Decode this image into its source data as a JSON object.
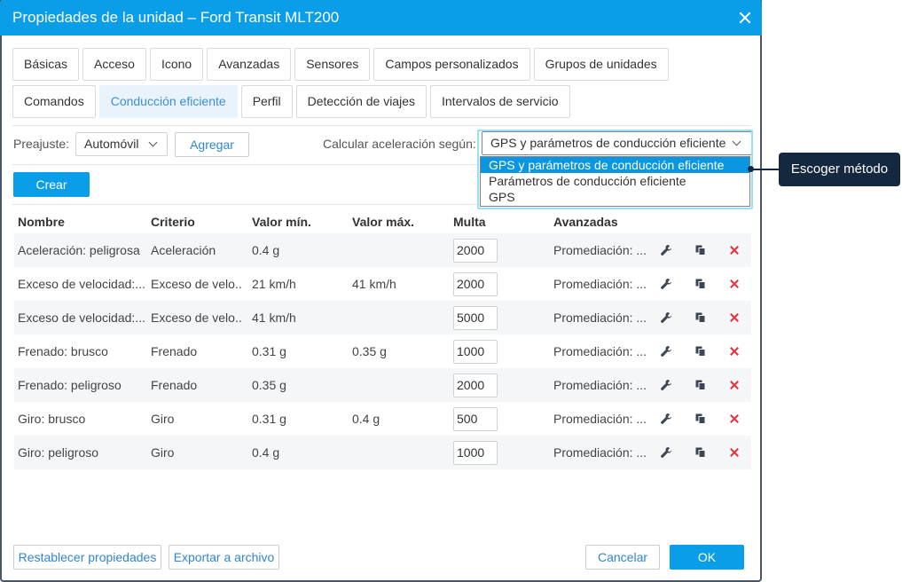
{
  "window": {
    "title": "Propiedades de la unidad – Ford Transit MLT200"
  },
  "tabs_row1": [
    "Básicas",
    "Acceso",
    "Icono",
    "Avanzadas",
    "Sensores",
    "Campos personalizados",
    "Grupos de unidades"
  ],
  "tabs_row2": [
    "Comandos",
    "Conducción eficiente",
    "Perfil",
    "Detección de viajes",
    "Intervalos de servicio"
  ],
  "active_tab": "Conducción eficiente",
  "toolbar": {
    "preset_label": "Preajuste:",
    "preset_value": "Automóvil",
    "add_label": "Agregar",
    "calc_label": "Calcular aceleración según:",
    "calc_value": "GPS y parámetros de conducción eficiente",
    "create_label": "Crear"
  },
  "dropdown": {
    "options": [
      "GPS y parámetros de conducción eficiente",
      "Parámetros de conducción eficiente",
      "GPS"
    ],
    "selected_index": 0
  },
  "callout": {
    "text": "Escoger método"
  },
  "table": {
    "headers": [
      "Nombre",
      "Criterio",
      "Valor mín.",
      "Valor máx.",
      "Multa",
      "Avanzadas"
    ],
    "rows": [
      {
        "name": "Aceleración: peligrosa",
        "criterion": "Aceleración",
        "min": "0.4 g",
        "max": "",
        "penalty": "2000",
        "advanced": "Promediación: ..."
      },
      {
        "name": "Exceso de velocidad:...",
        "criterion": "Exceso de velo...",
        "min": "21 km/h",
        "max": "41 km/h",
        "penalty": "2000",
        "advanced": "Promediación: ..."
      },
      {
        "name": "Exceso de velocidad:...",
        "criterion": "Exceso de velo...",
        "min": "41 km/h",
        "max": "",
        "penalty": "5000",
        "advanced": "Promediación: ..."
      },
      {
        "name": "Frenado: brusco",
        "criterion": "Frenado",
        "min": "0.31 g",
        "max": "0.35 g",
        "penalty": "1000",
        "advanced": "Promediación: ..."
      },
      {
        "name": "Frenado: peligroso",
        "criterion": "Frenado",
        "min": "0.35 g",
        "max": "",
        "penalty": "2000",
        "advanced": "Promediación: ..."
      },
      {
        "name": "Giro: brusco",
        "criterion": "Giro",
        "min": "0.31 g",
        "max": "0.4 g",
        "penalty": "500",
        "advanced": "Promediación: ..."
      },
      {
        "name": "Giro: peligroso",
        "criterion": "Giro",
        "min": "0.4 g",
        "max": "",
        "penalty": "1000",
        "advanced": "Promediación: ..."
      }
    ]
  },
  "footer": {
    "reset_label": "Restablecer propiedades",
    "export_label": "Exportar a archivo",
    "cancel_label": "Cancelar",
    "ok_label": "OK"
  },
  "colors": {
    "accent": "#0a9ee9",
    "delete": "#e3323a",
    "callout_bg": "#142840"
  }
}
